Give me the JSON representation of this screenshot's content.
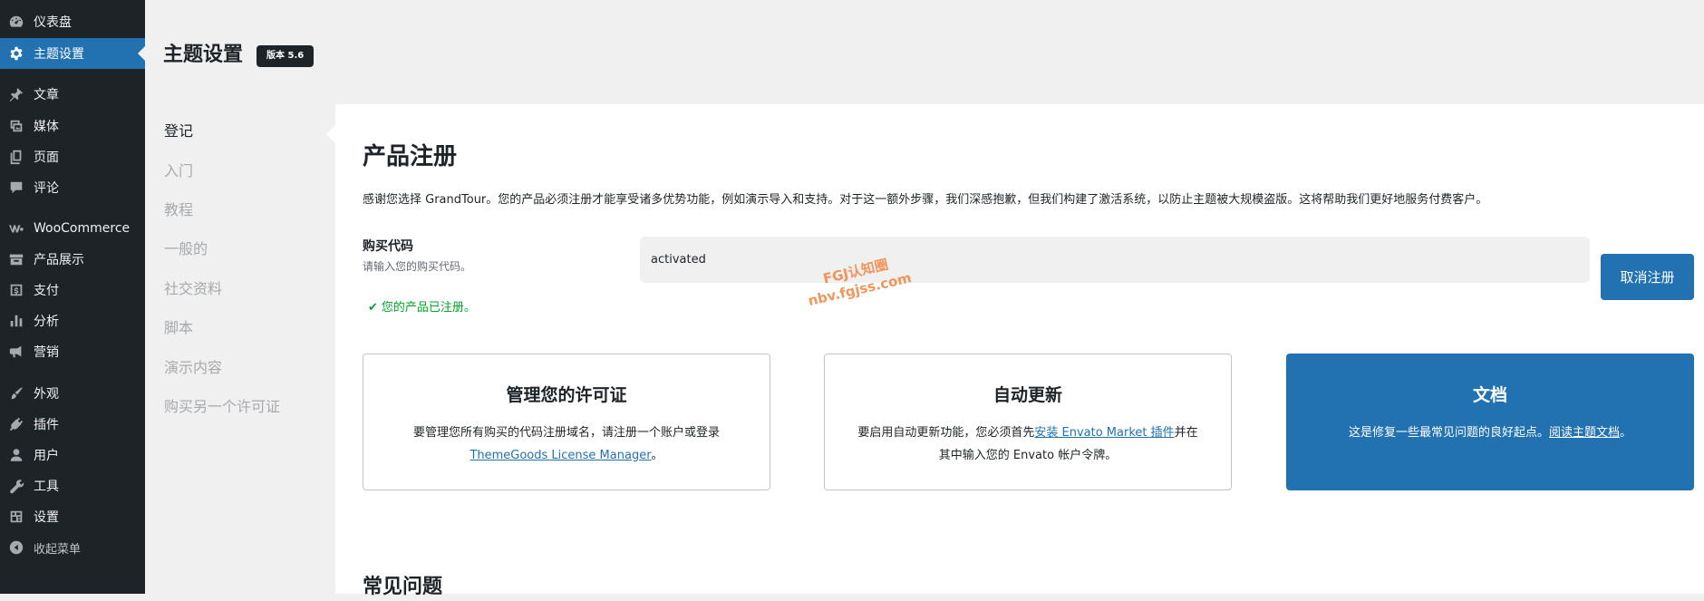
{
  "sidebar": {
    "items": [
      {
        "label": "仪表盘",
        "icon": "dashboard-icon"
      },
      {
        "label": "主题设置",
        "icon": "gear-icon",
        "active": true
      },
      {
        "label": "文章",
        "icon": "pin-icon"
      },
      {
        "label": "媒体",
        "icon": "media-icon"
      },
      {
        "label": "页面",
        "icon": "pages-icon"
      },
      {
        "label": "评论",
        "icon": "comment-icon"
      },
      {
        "label": "WooCommerce",
        "icon": "woocommerce-icon"
      },
      {
        "label": "产品展示",
        "icon": "archive-icon"
      },
      {
        "label": "支付",
        "icon": "payment-icon"
      },
      {
        "label": "分析",
        "icon": "bar-chart-icon"
      },
      {
        "label": "营销",
        "icon": "megaphone-icon"
      },
      {
        "label": "外观",
        "icon": "brush-icon"
      },
      {
        "label": "插件",
        "icon": "plugin-icon"
      },
      {
        "label": "用户",
        "icon": "user-icon"
      },
      {
        "label": "工具",
        "icon": "wrench-icon"
      },
      {
        "label": "设置",
        "icon": "settings-icon"
      },
      {
        "label": "收起菜单",
        "icon": "collapse-icon"
      }
    ]
  },
  "header": {
    "title": "主题设置",
    "version_badge": "版本 5.6"
  },
  "subnav": {
    "items": [
      "登记",
      "入门",
      "教程",
      "一般的",
      "社交资料",
      "脚本",
      "演示内容",
      "购买另一个许可证"
    ],
    "current_index": 0
  },
  "registration": {
    "title": "产品注册",
    "description": "感谢您选择 GrandTour。您的产品必须注册才能享受诸多优势功能，例如演示导入和支持。对于这一额外步骤，我们深感抱歉，但我们构建了激活系统，以防止主题被大规模盗版。这将帮助我们更好地服务付费客户。",
    "code_label": "购买代码",
    "code_hint": "请输入您的购买代码。",
    "code_value": "activated",
    "deactivate_label": "取消注册",
    "status_text": "您的产品已注册。"
  },
  "cards": {
    "license": {
      "title": "管理您的许可证",
      "text": "要管理您所有购买的代码注册域名，请注册一个账户或登录",
      "link": "ThemeGoods License Manager",
      "tail": "。"
    },
    "updates": {
      "title": "自动更新",
      "text_before": "要启用自动更新功能，您必须首先",
      "link": "安装 Envato Market 插件",
      "text_after": "并在其中输入您的 Envato 帐户令牌。"
    },
    "docs": {
      "title": "文档",
      "text": "这是修复一些最常见问题的良好起点。",
      "link": "阅读主题文档",
      "tail": "。"
    }
  },
  "faq": {
    "title": "常见问题"
  },
  "watermark": {
    "line1": "FGJ认知圈",
    "line2": "nbv.fgjss.com"
  },
  "colors": {
    "sidebar_bg": "#1d2327",
    "accent": "#2271b1",
    "success": "#00a32a",
    "watermark": "#f08b4c"
  }
}
